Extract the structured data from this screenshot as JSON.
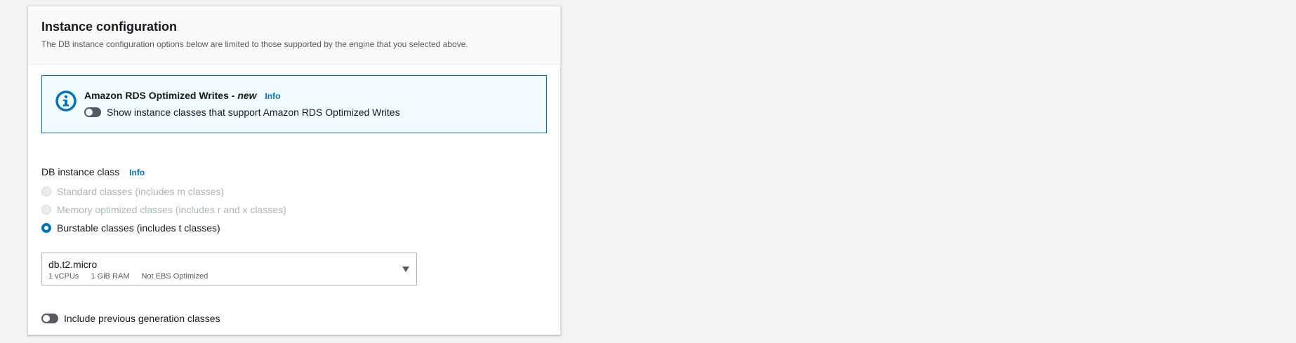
{
  "section": {
    "title": "Instance configuration",
    "description": "The DB instance configuration options below are limited to those supported by the engine that you selected above."
  },
  "optimized_writes": {
    "title": "Amazon RDS Optimized Writes - ",
    "title_new": "new",
    "info_link": "Info",
    "toggle_label": "Show instance classes that support Amazon RDS Optimized Writes",
    "toggle_on": false,
    "icon": "info-circle-icon"
  },
  "instance_class": {
    "label": "DB instance class",
    "info_link": "Info",
    "options": [
      {
        "label": "Standard classes (includes m classes)",
        "state": "disabled"
      },
      {
        "label": "Memory optimized classes (includes r and x classes)",
        "state": "disabled"
      },
      {
        "label": "Burstable classes (includes t classes)",
        "state": "selected"
      }
    ],
    "select": {
      "value": "db.t2.micro",
      "tags": [
        "1 vCPUs",
        "1 GiB RAM",
        "Not EBS Optimized"
      ]
    }
  },
  "previous_generation": {
    "toggle_label": "Include previous generation classes",
    "toggle_on": false
  },
  "colors": {
    "accent": "#0073bb",
    "info_bg": "#f1faff",
    "text": "#16191f",
    "disabled_text": "#aab7b8"
  }
}
